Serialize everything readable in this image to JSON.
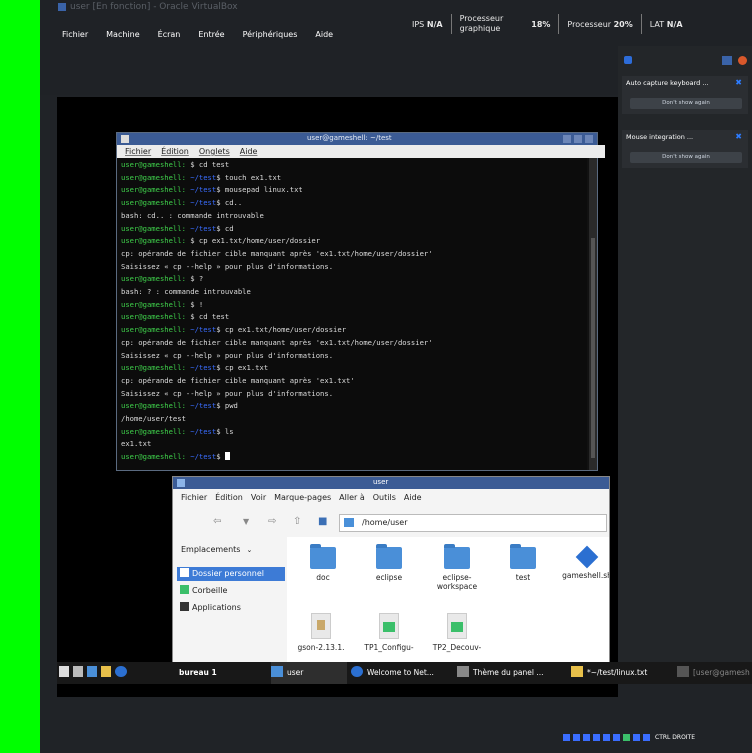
{
  "vbox": {
    "title": "user [En fonction] - Oracle VirtualBox",
    "menu": [
      "Fichier",
      "Machine",
      "Écran",
      "Entrée",
      "Périphériques",
      "Aide"
    ],
    "stats": {
      "ips_label": "IPS",
      "ips_value": "N/A",
      "cpu_graphics_label_1": "Processeur",
      "cpu_graphics_label_2": "graphique",
      "cpu_graphics_value": "18%",
      "cpu_label": "Processeur",
      "cpu_value": "20%",
      "lat_label": "LAT",
      "lat_value": "N/A"
    }
  },
  "notifications": [
    {
      "title": "Auto capture keyboard ...",
      "button": "Don't show again"
    },
    {
      "title": "Mouse integration ...",
      "button": "Don't show again"
    }
  ],
  "terminal": {
    "title": "user@gameshell: ~/test",
    "menu": [
      "Fichier",
      "Édition",
      "Onglets",
      "Aide"
    ],
    "lines": [
      {
        "prompt": "user@gameshell:",
        "dir": " ",
        "cmd": "$ cd test"
      },
      {
        "prompt": "user@gameshell:",
        "dir": " ~/test",
        "cmd": "$ touch ex1.txt"
      },
      {
        "prompt": "user@gameshell:",
        "dir": " ~/test",
        "cmd": "$ mousepad linux.txt"
      },
      {
        "prompt": "user@gameshell:",
        "dir": " ~/test",
        "cmd": "$ cd.."
      },
      {
        "text": "bash: cd.. : commande introuvable"
      },
      {
        "prompt": "user@gameshell:",
        "dir": " ~/test",
        "cmd": "$ cd"
      },
      {
        "prompt": "user@gameshell:",
        "dir": " ",
        "cmd": "$ cp ex1.txt/home/user/dossier"
      },
      {
        "text": "cp: opérande de fichier cible manquant après 'ex1.txt/home/user/dossier'"
      },
      {
        "text": "Saisissez « cp --help » pour plus d'informations."
      },
      {
        "prompt": "user@gameshell:",
        "dir": " ",
        "cmd": "$ ?"
      },
      {
        "text": "bash: ? : commande introuvable"
      },
      {
        "prompt": "user@gameshell:",
        "dir": " ",
        "cmd": "$ !"
      },
      {
        "prompt": "user@gameshell:",
        "dir": " ",
        "cmd": "$ cd test"
      },
      {
        "prompt": "user@gameshell:",
        "dir": " ~/test",
        "cmd": "$ cp ex1.txt/home/user/dossier"
      },
      {
        "text": "cp: opérande de fichier cible manquant après 'ex1.txt/home/user/dossier'"
      },
      {
        "text": "Saisissez « cp --help » pour plus d'informations."
      },
      {
        "prompt": "user@gameshell:",
        "dir": " ~/test",
        "cmd": "$ cp ex1.txt"
      },
      {
        "text": "cp: opérande de fichier cible manquant après 'ex1.txt'"
      },
      {
        "text": "Saisissez « cp --help » pour plus d'informations."
      },
      {
        "prompt": "user@gameshell:",
        "dir": " ~/test",
        "cmd": "$ pwd"
      },
      {
        "text": "/home/user/test"
      },
      {
        "prompt": "user@gameshell:",
        "dir": " ~/test",
        "cmd": "$ ls"
      },
      {
        "text": "ex1.txt"
      },
      {
        "prompt": "user@gameshell:",
        "dir": " ~/test",
        "cmd": "$ ",
        "cursor": true
      }
    ]
  },
  "filemanager": {
    "title": "user",
    "menu": [
      "Fichier",
      "Édition",
      "Voir",
      "Marque-pages",
      "Aller à",
      "Outils",
      "Aide"
    ],
    "path": "/home/user",
    "places_label": "Emplacements",
    "sidebar": [
      "Dossier personnel",
      "Corbeille",
      "Applications"
    ],
    "items": [
      "doc",
      "eclipse",
      "eclipse-workspace",
      "test",
      "gameshell.sh",
      "gson-2.13.1.",
      "TP1_Configu-",
      "TP2_Decouv-"
    ]
  },
  "taskbar": {
    "workspace": "bureau 1",
    "tasks": [
      "user",
      "Welcome to Net...",
      "Thème du panel ...",
      "*~/test/linux.txt",
      "[user@gamesh"
    ]
  },
  "tray_label": "CTRL DROITE"
}
